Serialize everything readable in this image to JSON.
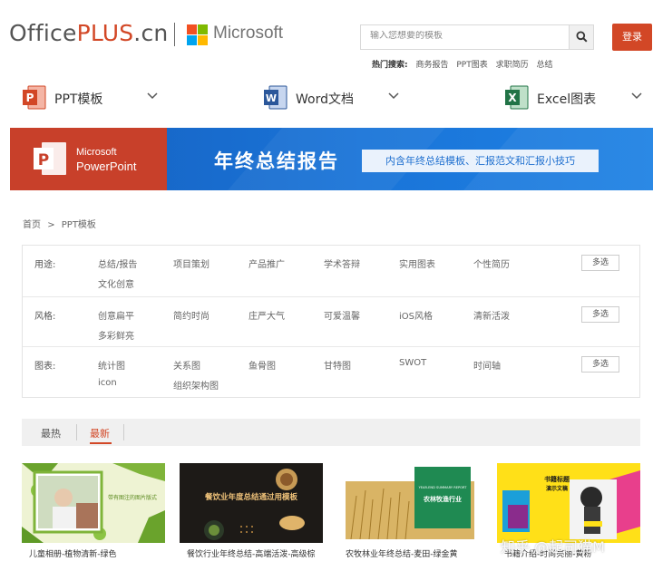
{
  "header": {
    "logo_office": "Office",
    "logo_plus": "PLUS",
    "logo_cn": ".cn",
    "partner": "Microsoft",
    "search_placeholder": "输入您想要的模板",
    "search_icon": "search-icon",
    "login_label": "登录",
    "hot_label": "热门搜索:",
    "hot_terms": [
      "商务报告",
      "PPT图表",
      "求职简历",
      "总结"
    ]
  },
  "products": [
    {
      "label": "PPT模板",
      "color": "#d24726"
    },
    {
      "label": "Word文档",
      "color": "#2b579a"
    },
    {
      "label": "Excel图表",
      "color": "#217346"
    }
  ],
  "banner": {
    "brand_line1": "Microsoft",
    "brand_line2": "PowerPoint",
    "title": "年终总结报告",
    "pill": "内含年终总结模板、汇报范文和汇报小技巧"
  },
  "breadcrumb": {
    "home": "首页",
    "sep": ">",
    "current": "PPT模板"
  },
  "filters": [
    {
      "label": "用途:",
      "options": [
        "总结/报告",
        "项目策划",
        "产品推广",
        "学术答辩",
        "实用图表",
        "个性简历",
        "文化创意"
      ],
      "multi": "多选"
    },
    {
      "label": "风格:",
      "options": [
        "创意扁平",
        "简约时尚",
        "庄严大气",
        "可爱温馨",
        "iOS风格",
        "清新活泼",
        "多彩鲜亮"
      ],
      "multi": "多选"
    },
    {
      "label": "图表:",
      "options": [
        "统计图",
        "关系图",
        "鱼骨图",
        "甘特图",
        "SWOT",
        "时间轴",
        "icon",
        "组织架构图"
      ],
      "multi": "多选"
    }
  ],
  "sort": {
    "tabs": [
      "最热",
      "最新"
    ],
    "active": "最新"
  },
  "cards": [
    {
      "title": "儿童相册-植物清新-绿色",
      "thumb_text": "带有图注的图片版式"
    },
    {
      "title": "餐饮行业年终总结-高端活泼-高级棕",
      "thumb_text": "餐饮业年度总结通过用模板"
    },
    {
      "title": "农牧林业年终总结-麦田-绿金黄",
      "thumb_text_1": "YEAR-END SUMMARY REPORT",
      "thumb_text_2": "农林牧渔行业"
    },
    {
      "title": "书籍介绍-时尚亮丽-黄粉",
      "thumb_text_1": "书籍标题",
      "thumb_text_2": "演示文稿"
    }
  ],
  "watermark": "知乎 @起司猫M",
  "colors": {
    "accent": "#d24726",
    "banner_blue": "#1a74d8",
    "word_blue": "#2b579a",
    "excel_green": "#217346"
  }
}
